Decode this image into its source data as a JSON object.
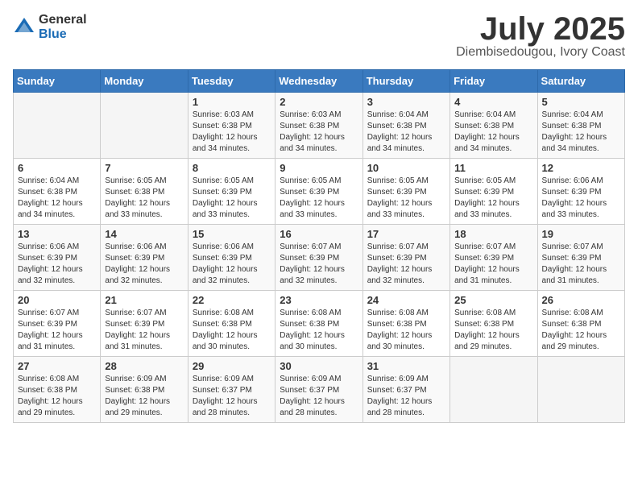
{
  "logo": {
    "general": "General",
    "blue": "Blue"
  },
  "title": "July 2025",
  "subtitle": "Diembisedougou, Ivory Coast",
  "days_of_week": [
    "Sunday",
    "Monday",
    "Tuesday",
    "Wednesday",
    "Thursday",
    "Friday",
    "Saturday"
  ],
  "weeks": [
    [
      {
        "day": "",
        "info": ""
      },
      {
        "day": "",
        "info": ""
      },
      {
        "day": "1",
        "info": "Sunrise: 6:03 AM\nSunset: 6:38 PM\nDaylight: 12 hours and 34 minutes."
      },
      {
        "day": "2",
        "info": "Sunrise: 6:03 AM\nSunset: 6:38 PM\nDaylight: 12 hours and 34 minutes."
      },
      {
        "day": "3",
        "info": "Sunrise: 6:04 AM\nSunset: 6:38 PM\nDaylight: 12 hours and 34 minutes."
      },
      {
        "day": "4",
        "info": "Sunrise: 6:04 AM\nSunset: 6:38 PM\nDaylight: 12 hours and 34 minutes."
      },
      {
        "day": "5",
        "info": "Sunrise: 6:04 AM\nSunset: 6:38 PM\nDaylight: 12 hours and 34 minutes."
      }
    ],
    [
      {
        "day": "6",
        "info": "Sunrise: 6:04 AM\nSunset: 6:38 PM\nDaylight: 12 hours and 34 minutes."
      },
      {
        "day": "7",
        "info": "Sunrise: 6:05 AM\nSunset: 6:38 PM\nDaylight: 12 hours and 33 minutes."
      },
      {
        "day": "8",
        "info": "Sunrise: 6:05 AM\nSunset: 6:39 PM\nDaylight: 12 hours and 33 minutes."
      },
      {
        "day": "9",
        "info": "Sunrise: 6:05 AM\nSunset: 6:39 PM\nDaylight: 12 hours and 33 minutes."
      },
      {
        "day": "10",
        "info": "Sunrise: 6:05 AM\nSunset: 6:39 PM\nDaylight: 12 hours and 33 minutes."
      },
      {
        "day": "11",
        "info": "Sunrise: 6:05 AM\nSunset: 6:39 PM\nDaylight: 12 hours and 33 minutes."
      },
      {
        "day": "12",
        "info": "Sunrise: 6:06 AM\nSunset: 6:39 PM\nDaylight: 12 hours and 33 minutes."
      }
    ],
    [
      {
        "day": "13",
        "info": "Sunrise: 6:06 AM\nSunset: 6:39 PM\nDaylight: 12 hours and 32 minutes."
      },
      {
        "day": "14",
        "info": "Sunrise: 6:06 AM\nSunset: 6:39 PM\nDaylight: 12 hours and 32 minutes."
      },
      {
        "day": "15",
        "info": "Sunrise: 6:06 AM\nSunset: 6:39 PM\nDaylight: 12 hours and 32 minutes."
      },
      {
        "day": "16",
        "info": "Sunrise: 6:07 AM\nSunset: 6:39 PM\nDaylight: 12 hours and 32 minutes."
      },
      {
        "day": "17",
        "info": "Sunrise: 6:07 AM\nSunset: 6:39 PM\nDaylight: 12 hours and 32 minutes."
      },
      {
        "day": "18",
        "info": "Sunrise: 6:07 AM\nSunset: 6:39 PM\nDaylight: 12 hours and 31 minutes."
      },
      {
        "day": "19",
        "info": "Sunrise: 6:07 AM\nSunset: 6:39 PM\nDaylight: 12 hours and 31 minutes."
      }
    ],
    [
      {
        "day": "20",
        "info": "Sunrise: 6:07 AM\nSunset: 6:39 PM\nDaylight: 12 hours and 31 minutes."
      },
      {
        "day": "21",
        "info": "Sunrise: 6:07 AM\nSunset: 6:39 PM\nDaylight: 12 hours and 31 minutes."
      },
      {
        "day": "22",
        "info": "Sunrise: 6:08 AM\nSunset: 6:38 PM\nDaylight: 12 hours and 30 minutes."
      },
      {
        "day": "23",
        "info": "Sunrise: 6:08 AM\nSunset: 6:38 PM\nDaylight: 12 hours and 30 minutes."
      },
      {
        "day": "24",
        "info": "Sunrise: 6:08 AM\nSunset: 6:38 PM\nDaylight: 12 hours and 30 minutes."
      },
      {
        "day": "25",
        "info": "Sunrise: 6:08 AM\nSunset: 6:38 PM\nDaylight: 12 hours and 29 minutes."
      },
      {
        "day": "26",
        "info": "Sunrise: 6:08 AM\nSunset: 6:38 PM\nDaylight: 12 hours and 29 minutes."
      }
    ],
    [
      {
        "day": "27",
        "info": "Sunrise: 6:08 AM\nSunset: 6:38 PM\nDaylight: 12 hours and 29 minutes."
      },
      {
        "day": "28",
        "info": "Sunrise: 6:09 AM\nSunset: 6:38 PM\nDaylight: 12 hours and 29 minutes."
      },
      {
        "day": "29",
        "info": "Sunrise: 6:09 AM\nSunset: 6:37 PM\nDaylight: 12 hours and 28 minutes."
      },
      {
        "day": "30",
        "info": "Sunrise: 6:09 AM\nSunset: 6:37 PM\nDaylight: 12 hours and 28 minutes."
      },
      {
        "day": "31",
        "info": "Sunrise: 6:09 AM\nSunset: 6:37 PM\nDaylight: 12 hours and 28 minutes."
      },
      {
        "day": "",
        "info": ""
      },
      {
        "day": "",
        "info": ""
      }
    ]
  ]
}
